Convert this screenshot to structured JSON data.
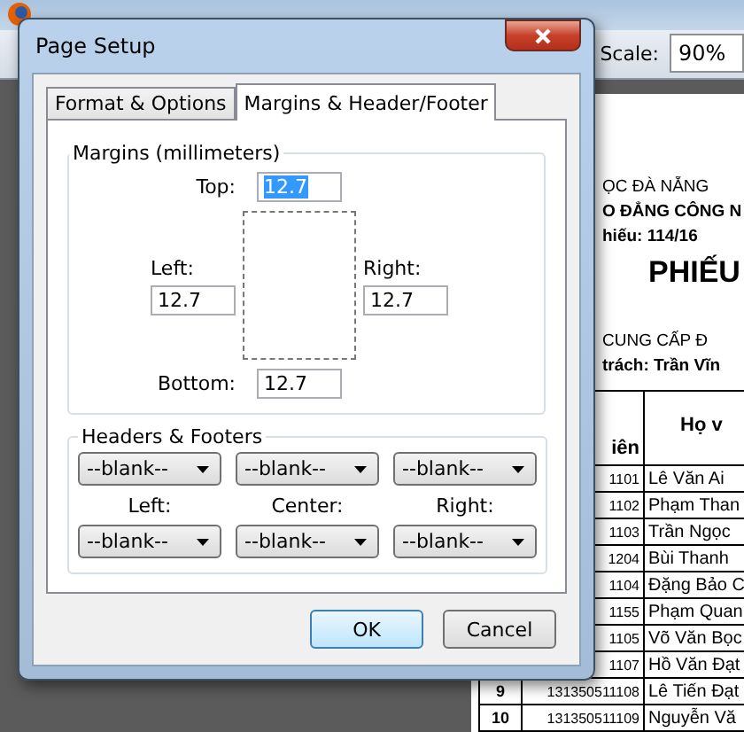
{
  "browser": {
    "scale_label": "Scale:",
    "scale_value": "90%"
  },
  "document": {
    "lines": [
      {
        "text": "ỌC ĐÀ NẴNG",
        "kind": "plain"
      },
      {
        "text": "O ĐẲNG CÔNG N",
        "kind": "bold"
      },
      {
        "text": "hiếu: 114/16",
        "kind": "bold"
      },
      {
        "text": "PHIẾU",
        "kind": "title"
      },
      {
        "text": "CUNG CẤP Đ",
        "kind": "plain"
      },
      {
        "text": "trách: Trần Vĩn",
        "kind": "mixed"
      }
    ],
    "columns": [
      "iên",
      "Họ v"
    ],
    "rows": [
      {
        "no": "",
        "id": "1101",
        "name": "Lê Văn Ai"
      },
      {
        "no": "",
        "id": "1102",
        "name": "Phạm Than"
      },
      {
        "no": "",
        "id": "1103",
        "name": "Trần Ngọc"
      },
      {
        "no": "",
        "id": "1204",
        "name": "Bùi Thanh"
      },
      {
        "no": "",
        "id": "1104",
        "name": "Đặng Bảo C"
      },
      {
        "no": "",
        "id": "1155",
        "name": "Phạm Quan"
      },
      {
        "no": "",
        "id": "1105",
        "name": "Võ Văn Bọc"
      },
      {
        "no": "",
        "id": "1107",
        "name": "Hồ Văn Đạt"
      },
      {
        "no": "9",
        "id": "131350511108",
        "name": "Lê Tiến Đạt"
      },
      {
        "no": "10",
        "id": "131350511109",
        "name": "Nguyễn Vă"
      }
    ]
  },
  "dialog": {
    "title": "Page Setup",
    "tabs": [
      {
        "label": "Format & Options",
        "selected": false
      },
      {
        "label": "Margins & Header/Footer",
        "selected": true
      }
    ],
    "margins": {
      "legend": "Margins (millimeters)",
      "top": {
        "label": "Top:",
        "value": "12.7",
        "selected": true
      },
      "left": {
        "label": "Left:",
        "value": "12.7",
        "selected": false
      },
      "right": {
        "label": "Right:",
        "value": "12.7",
        "selected": false
      },
      "bottom": {
        "label": "Bottom:",
        "value": "12.7",
        "selected": false
      }
    },
    "headers_footers": {
      "legend": "Headers & Footers",
      "headers": [
        "--blank--",
        "--blank--",
        "--blank--"
      ],
      "labels": [
        "Left:",
        "Center:",
        "Right:"
      ],
      "footers": [
        "--blank--",
        "--blank--",
        "--blank--"
      ]
    },
    "buttons": [
      {
        "label": "OK",
        "default": true
      },
      {
        "label": "Cancel",
        "default": false
      }
    ]
  }
}
